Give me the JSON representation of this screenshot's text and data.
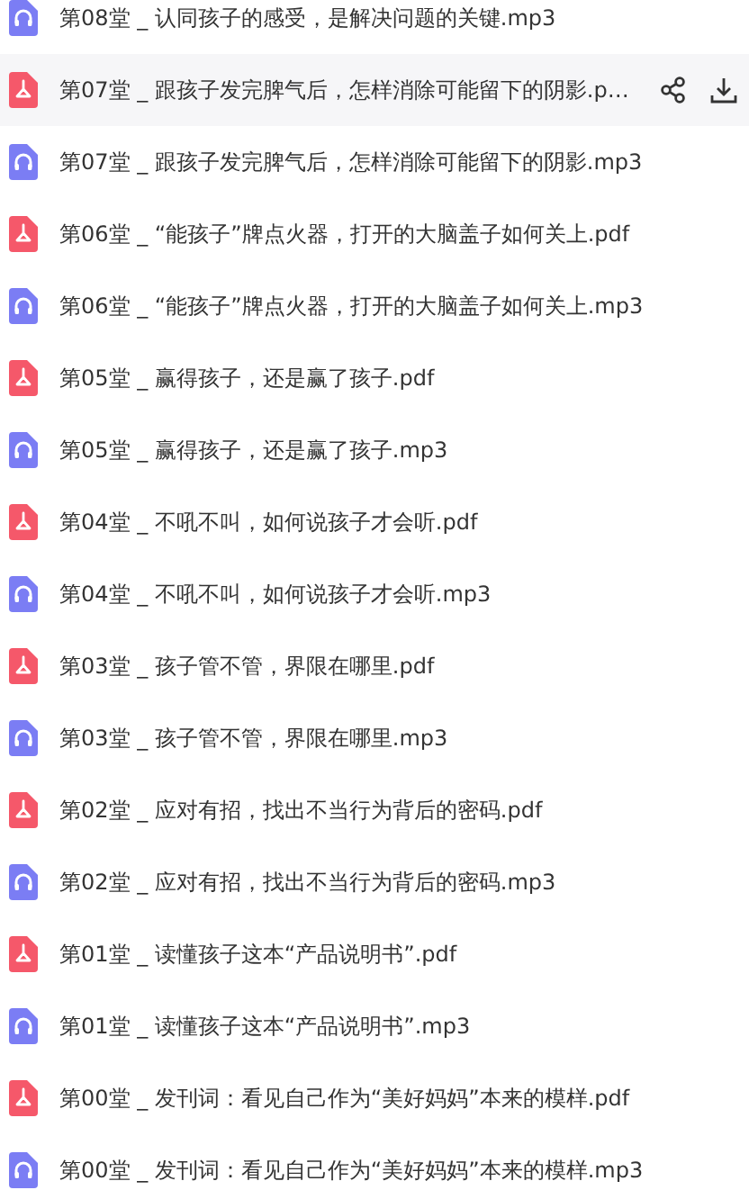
{
  "files": [
    {
      "kind": "audio",
      "name": "第08堂 _ 认同孩子的感受，是解决问题的关键.mp3",
      "hovered": false
    },
    {
      "kind": "pdf",
      "name": "第07堂 _ 跟孩子发完脾气后，怎样消除可能留下的阴影.p…",
      "hovered": true
    },
    {
      "kind": "audio",
      "name": "第07堂 _ 跟孩子发完脾气后，怎样消除可能留下的阴影.mp3",
      "hovered": false
    },
    {
      "kind": "pdf",
      "name": "第06堂 _ “能孩子”牌点火器，打开的大脑盖子如何关上.pdf",
      "hovered": false
    },
    {
      "kind": "audio",
      "name": "第06堂 _ “能孩子”牌点火器，打开的大脑盖子如何关上.mp3",
      "hovered": false
    },
    {
      "kind": "pdf",
      "name": "第05堂 _ 赢得孩子，还是赢了孩子.pdf",
      "hovered": false
    },
    {
      "kind": "audio",
      "name": "第05堂 _ 赢得孩子，还是赢了孩子.mp3",
      "hovered": false
    },
    {
      "kind": "pdf",
      "name": "第04堂 _ 不吼不叫，如何说孩子才会听.pdf",
      "hovered": false
    },
    {
      "kind": "audio",
      "name": "第04堂 _ 不吼不叫，如何说孩子才会听.mp3",
      "hovered": false
    },
    {
      "kind": "pdf",
      "name": "第03堂 _ 孩子管不管，界限在哪里.pdf",
      "hovered": false
    },
    {
      "kind": "audio",
      "name": "第03堂 _ 孩子管不管，界限在哪里.mp3",
      "hovered": false
    },
    {
      "kind": "pdf",
      "name": "第02堂 _ 应对有招，找出不当行为背后的密码.pdf",
      "hovered": false
    },
    {
      "kind": "audio",
      "name": "第02堂 _ 应对有招，找出不当行为背后的密码.mp3",
      "hovered": false
    },
    {
      "kind": "pdf",
      "name": "第01堂 _ 读懂孩子这本“产品说明书”.pdf",
      "hovered": false
    },
    {
      "kind": "audio",
      "name": "第01堂 _ 读懂孩子这本“产品说明书”.mp3",
      "hovered": false
    },
    {
      "kind": "pdf",
      "name": "第00堂 _ 发刊词：看见自己作为“美好妈妈”本来的模样.pdf",
      "hovered": false
    },
    {
      "kind": "audio",
      "name": "第00堂 _ 发刊词：看见自己作为“美好妈妈”本来的模样.mp3",
      "hovered": false
    }
  ]
}
